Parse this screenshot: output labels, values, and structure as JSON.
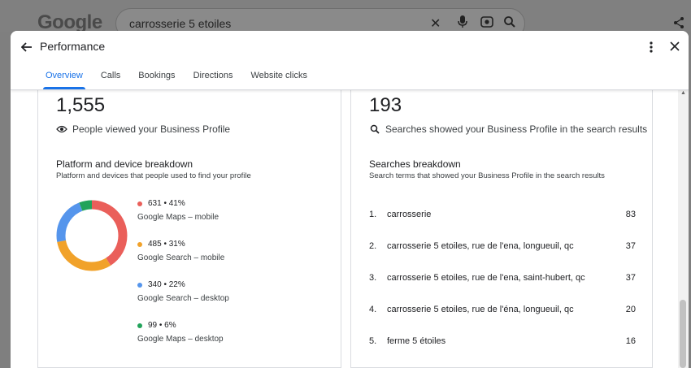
{
  "background": {
    "logo": "Google",
    "search_query": "carrosserie 5 etoiles"
  },
  "dialog": {
    "title": "Performance",
    "tabs": [
      "Overview",
      "Calls",
      "Bookings",
      "Directions",
      "Website clicks"
    ],
    "active_tab": "Overview"
  },
  "left_card": {
    "total": "1,555",
    "subtitle": "People viewed your Business Profile",
    "section_title": "Platform and device breakdown",
    "section_desc": "Platform and devices that people used to find your profile",
    "breakdown": [
      {
        "value": "631 • 41%",
        "label": "Google Maps – mobile",
        "color": "#ea5f5a",
        "pct": 41
      },
      {
        "value": "485 • 31%",
        "label": "Google Search – mobile",
        "color": "#f1a22a",
        "pct": 31
      },
      {
        "value": "340 • 22%",
        "label": "Google Search – desktop",
        "color": "#5595ec",
        "pct": 22
      },
      {
        "value": "99 • 6%",
        "label": "Google Maps – desktop",
        "color": "#22a35a",
        "pct": 6
      }
    ]
  },
  "right_card": {
    "total": "193",
    "subtitle": "Searches showed your Business Profile in the search results",
    "section_title": "Searches breakdown",
    "section_desc": "Search terms that showed your Business Profile in the search results",
    "searches": [
      {
        "index": "1.",
        "term": "carrosserie",
        "count": "83"
      },
      {
        "index": "2.",
        "term": "carrosserie 5 etoiles, rue de l'ena, longueuil, qc",
        "count": "37"
      },
      {
        "index": "3.",
        "term": "carrosserie 5 etoiles, rue de l'ena, saint-hubert, qc",
        "count": "37"
      },
      {
        "index": "4.",
        "term": "carrosserie 5 etoiles, rue de l'éna, longueuil, qc",
        "count": "20"
      },
      {
        "index": "5.",
        "term": "ferme 5 étoiles",
        "count": "16"
      }
    ]
  }
}
